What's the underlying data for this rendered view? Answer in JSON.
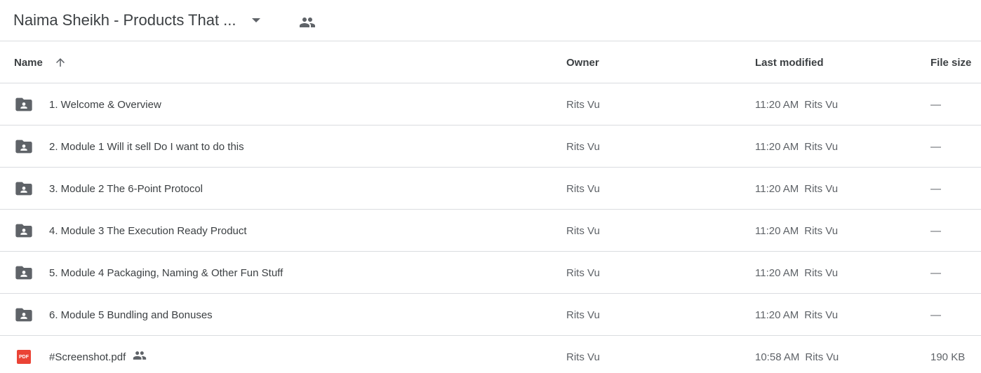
{
  "header": {
    "title": "Naima Sheikh - Products That ...",
    "icons": {
      "caret": "chevron-down-icon",
      "share": "people-icon"
    }
  },
  "columns": {
    "name": "Name",
    "owner": "Owner",
    "modified": "Last modified",
    "size": "File size"
  },
  "rows": [
    {
      "name": "1. Welcome & Overview",
      "type": "shared-folder",
      "owner": "Rits Vu",
      "modified_time": "11:20 AM",
      "modified_by": "Rits Vu",
      "size": "—"
    },
    {
      "name": "2. Module 1 Will it sell Do I want to do this",
      "type": "shared-folder",
      "owner": "Rits Vu",
      "modified_time": "11:20 AM",
      "modified_by": "Rits Vu",
      "size": "—"
    },
    {
      "name": "3. Module 2 The 6-Point Protocol",
      "type": "shared-folder",
      "owner": "Rits Vu",
      "modified_time": "11:20 AM",
      "modified_by": "Rits Vu",
      "size": "—"
    },
    {
      "name": "4. Module 3 The Execution Ready Product",
      "type": "shared-folder",
      "owner": "Rits Vu",
      "modified_time": "11:20 AM",
      "modified_by": "Rits Vu",
      "size": "—"
    },
    {
      "name": "5. Module 4 Packaging, Naming & Other Fun Stuff",
      "type": "shared-folder",
      "owner": "Rits Vu",
      "modified_time": "11:20 AM",
      "modified_by": "Rits Vu",
      "size": "—"
    },
    {
      "name": "6. Module 5 Bundling and Bonuses",
      "type": "shared-folder",
      "owner": "Rits Vu",
      "modified_time": "11:20 AM",
      "modified_by": "Rits Vu",
      "size": "—"
    },
    {
      "name": "#Screenshot.pdf",
      "type": "pdf",
      "badge": "PDF",
      "owner": "Rits Vu",
      "modified_time": "10:58 AM",
      "modified_by": "Rits Vu",
      "size": "190 KB"
    }
  ],
  "colors": {
    "pdf": "#ea4335",
    "folder": "#5f6368",
    "divider": "#dadce0"
  }
}
